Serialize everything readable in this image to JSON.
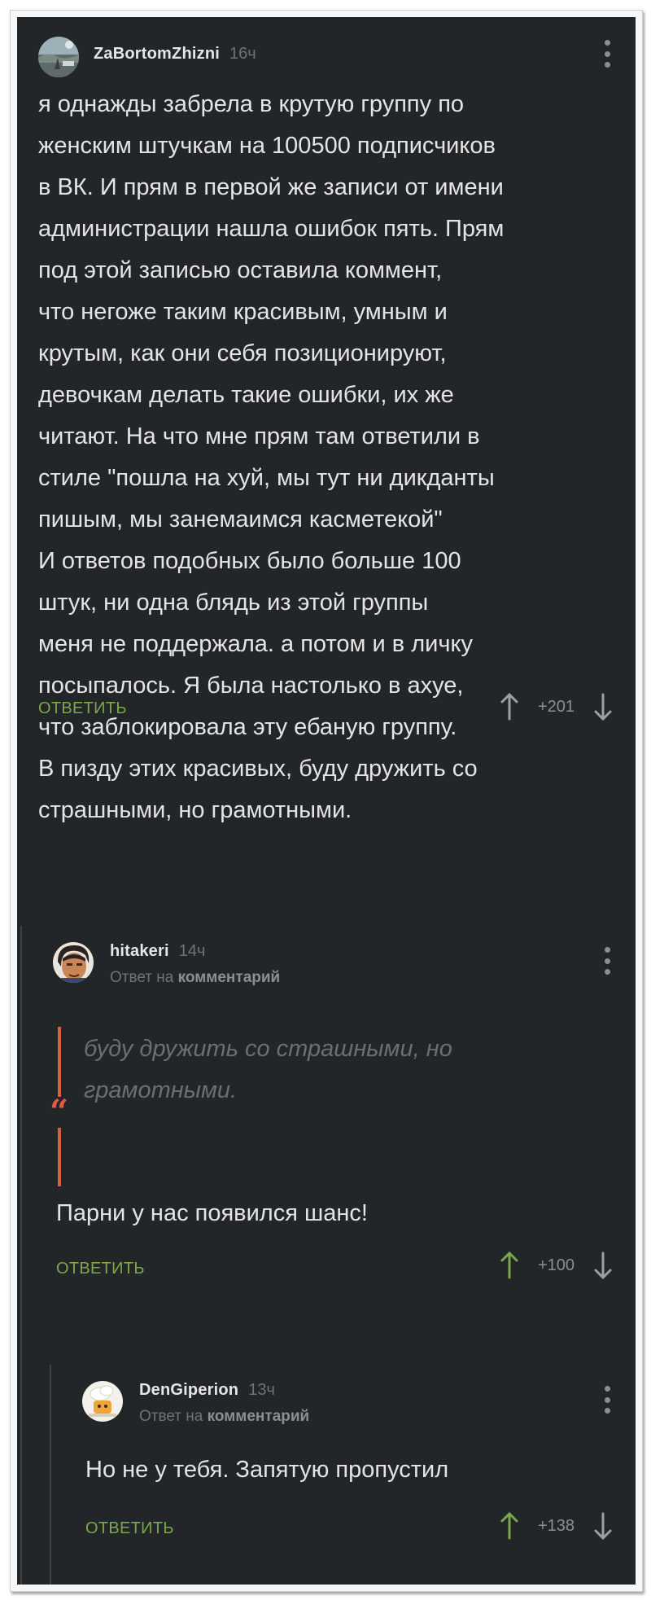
{
  "colors": {
    "background": "#232629",
    "accent_green": "#7aa84a",
    "quote_red": "#e05a47",
    "muted": "#6e7378"
  },
  "comments": [
    {
      "username": "ZaBortomZhizni",
      "time": "16ч",
      "text": "я однажды забрела в крутую группу по\nженским штучкам на 100500 подписчиков\nв ВК. И прям в первой же записи от имени\nадминистрации нашла ошибок пять. Прям\nпод этой записью оставила коммент,\nчто негоже таким красивым, умным и\nкрутым, как они себя позиционируют,\nдевочкам делать такие ошибки, их же\nчитают. На что мне прям там ответили в\nстиле \"пошла на хуй, мы тут ни дикданты\nпишым, мы занемаимся касметекой\"\nИ ответов подобных было больше 100\nштук, ни одна блядь из этой группы\nменя не поддержала. а потом и в личку\nпосыпалось. Я была настолько в ахуе,\nчто заблокировала эту ебаную группу.\nВ пизду этих красивых, буду дружить со\nстрашными, но грамотными.",
      "reply_label": "ОТВЕТИТЬ",
      "score": "+201",
      "upvote_active": false,
      "avatar_icon": "landscape-avatar"
    },
    {
      "username": "hitakeri",
      "time": "14ч",
      "reply_prefix": "Ответ на",
      "reply_target": "комментарий",
      "quote": "буду дружить со страшными, но\nграмотными.",
      "quote_mark": "“",
      "text": "Парни у нас появился шанс!",
      "reply_label": "ОТВЕТИТЬ",
      "score": "+100",
      "upvote_active": true,
      "avatar_icon": "anime-face-avatar"
    },
    {
      "username": "DenGiperion",
      "time": "13ч",
      "reply_prefix": "Ответ на",
      "reply_target": "комментарий",
      "text": "Но не у тебя. Запятую пропустил",
      "reply_label": "ОТВЕТИТЬ",
      "score": "+138",
      "upvote_active": true,
      "avatar_icon": "cartoon-avatar"
    }
  ]
}
